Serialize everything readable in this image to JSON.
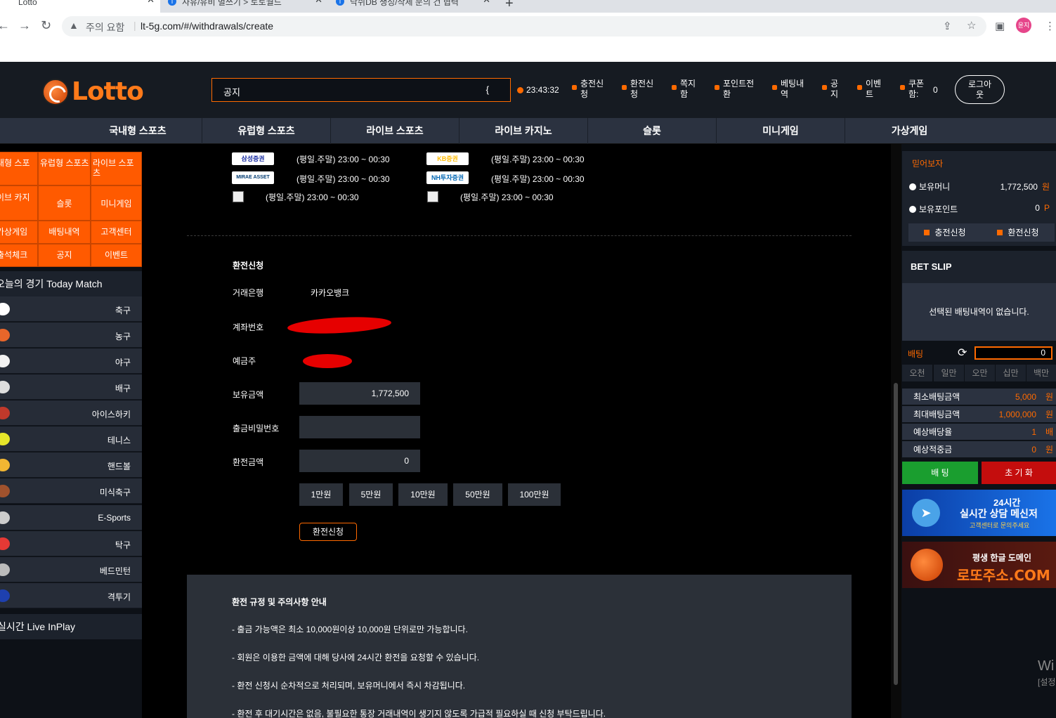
{
  "browser": {
    "tabs": [
      {
        "label": "Lotto"
      },
      {
        "label": "사유/유비 별쓰기 > 토토월드"
      },
      {
        "label": "낙쉬DB 생성/삭제 문의 건 협력"
      }
    ],
    "new_tab": "+",
    "warning": "주의 요함",
    "url": "lt-5g.com/#/withdrawals/create",
    "profile_label": "윤지"
  },
  "header": {
    "logo_text": "Lotto",
    "notice_text": "공지",
    "notice_marquee": "{",
    "clock": "23:43:32",
    "items": [
      {
        "label": "충전신\n청"
      },
      {
        "label": "환전신\n청"
      },
      {
        "label": "쪽지\n함"
      },
      {
        "label": "포인트전\n환"
      },
      {
        "label": "베팅내\n역"
      },
      {
        "label": "공\n지"
      },
      {
        "label": "이벤\n트"
      },
      {
        "label": "쿠폰\n함:"
      }
    ],
    "coupon_count": "0",
    "logout_label": "로그아\n웃"
  },
  "nav": [
    {
      "label": "국내형 스포츠"
    },
    {
      "label": "유럽형 스포츠"
    },
    {
      "label": "라이브 스포츠"
    },
    {
      "label": "라이브 카지노"
    },
    {
      "label": "슬롯"
    },
    {
      "label": "미니게임"
    },
    {
      "label": "가상게임"
    }
  ],
  "sidebar": {
    "quick": [
      {
        "label": "내형 스포"
      },
      {
        "label": "유럽형 스포츠"
      },
      {
        "label": "라이브 스포츠"
      },
      {
        "label": "이브 카지"
      },
      {
        "label": "슬롯"
      },
      {
        "label": "미니게임"
      },
      {
        "label": "가상게임"
      },
      {
        "label": "배팅내역"
      },
      {
        "label": "고객센터"
      },
      {
        "label": "출석체크"
      },
      {
        "label": "공지"
      },
      {
        "label": "이벤트"
      }
    ],
    "today_title": "오늘의 경기 Today Match",
    "sports": [
      {
        "label": "축구",
        "icon": "soccer-icon",
        "color": "#ffffff"
      },
      {
        "label": "농구",
        "icon": "basketball-icon",
        "color": "#e8662a"
      },
      {
        "label": "야구",
        "icon": "baseball-icon",
        "color": "#f2f2f2"
      },
      {
        "label": "배구",
        "icon": "volleyball-icon",
        "color": "#dddddd"
      },
      {
        "label": "아이스하키",
        "icon": "hockey-icon",
        "color": "#c0392b"
      },
      {
        "label": "테니스",
        "icon": "tennis-icon",
        "color": "#e6e62a"
      },
      {
        "label": "핸드볼",
        "icon": "handball-icon",
        "color": "#f2b632"
      },
      {
        "label": "미식축구",
        "icon": "football-icon",
        "color": "#a0522d"
      },
      {
        "label": "E-Sports",
        "icon": "gamepad-icon",
        "color": "#cccccc"
      },
      {
        "label": "탁구",
        "icon": "pingpong-icon",
        "color": "#e53935"
      },
      {
        "label": "베드민턴",
        "icon": "shuttlecock-icon",
        "color": "#bbbbbb"
      },
      {
        "label": "격투기",
        "icon": "boxing-glove-icon",
        "color": "#1e40af"
      }
    ],
    "live_title": "실시간 Live InPlay"
  },
  "banks": [
    {
      "logo": "삼성증권",
      "time": "(평일.주말) 23:00 ~ 00:30",
      "color": "#1428a0"
    },
    {
      "logo": "KB증권",
      "time": "(평일.주말) 23:00 ~ 00:30",
      "color": "#ffbc00"
    },
    {
      "logo": "MIRAE ASSET",
      "time": "(평일.주말) 23:00 ~ 00:30",
      "color": "#003a70"
    },
    {
      "logo": "NH투자증권",
      "time": "(평일.주말) 23:00 ~ 00:30",
      "color": "#0066b3"
    },
    {
      "logo": "",
      "time": "(평일.주말) 23:00 ~ 00:30"
    },
    {
      "logo": "",
      "time": "(평일.주말) 23:00 ~ 00:30"
    }
  ],
  "form": {
    "title": "환전신청",
    "bank_label": "거래은행",
    "bank_value": "카카오뱅크",
    "account_label": "계좌번호",
    "holder_label": "예금주",
    "balance_label": "보유금액",
    "balance_value": "1,772,500",
    "password_label": "출금비밀번호",
    "password_value": "",
    "amount_label": "환전금액",
    "amount_value": "0",
    "amount_buttons": [
      {
        "label": "1만원"
      },
      {
        "label": "5만원"
      },
      {
        "label": "10만원"
      },
      {
        "label": "50만원"
      },
      {
        "label": "100만원"
      }
    ],
    "submit_label": "환전신청"
  },
  "rules": {
    "title": "환전 규정 및 주의사항 안내",
    "lines": [
      "- 출금 가능액은 최소 10,000원이상 10,000원 단위로만 가능합니다.",
      "- 회원은 이용한 금액에 대해 당사에 24시간 환전을 요청할 수 있습니다.",
      "- 환전 신청시 순차적으로 처리되며, 보유머니에서 즉시 차감됩니다.",
      "- 환전 후 대기시간은 없음, 불필요한 통장 거래내역이 생기지 않도록 가급적 필요하실 때 신청 부탁드립니다."
    ]
  },
  "user": {
    "name": "믿어보자",
    "money_label": "보유머니",
    "money_value": "1,772,500",
    "money_unit": "원",
    "point_label": "보유포인트",
    "point_value": "0",
    "point_unit": "P",
    "deposit_label": "충전신청",
    "withdraw_label": "환전신청"
  },
  "betslip": {
    "title": "BET SLIP",
    "empty": "선택된 배팅내역이 없습니다.",
    "bet_label": "배팅",
    "bet_value": "0",
    "chips": [
      {
        "label": "오천"
      },
      {
        "label": "일만"
      },
      {
        "label": "오만"
      },
      {
        "label": "십만"
      },
      {
        "label": "백만"
      }
    ],
    "rows": [
      {
        "label": "최소배팅금액",
        "value": "5,000",
        "unit": "원"
      },
      {
        "label": "최대배팅금액",
        "value": "1,000,000",
        "unit": "원"
      },
      {
        "label": "예상배당율",
        "value": "1",
        "unit": "배"
      },
      {
        "label": "예상적중금",
        "value": "0",
        "unit": "원"
      }
    ],
    "bet_button": "배 팅",
    "reset_button": "초 기 화"
  },
  "banners": {
    "b1_line1": "24시간",
    "b1_line2": "실시간 상담 메신저",
    "b1_line3": "고객센터로 문의주세요",
    "b2_line1": "평생 한글 도메인",
    "b2_line2": "로또주소.COM"
  },
  "watermark": {
    "line1": "Wi",
    "line2": "[설정"
  }
}
